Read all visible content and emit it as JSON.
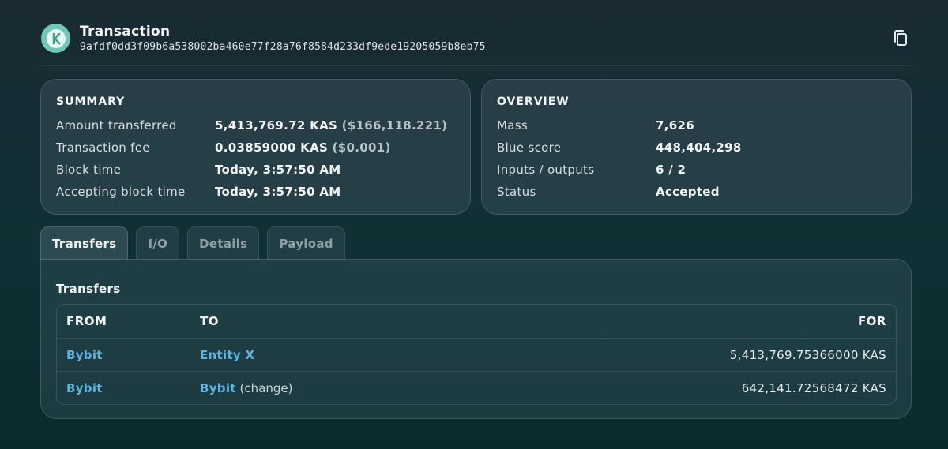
{
  "header": {
    "title": "Transaction",
    "hash": "9afdf0dd3f09b6a538002ba460e77f28a76f8584d233df9ede19205059b8eb75",
    "logo_icon": "kaspa-logo-icon",
    "copy_icon": "copy-icon"
  },
  "summary": {
    "heading": "SUMMARY",
    "rows": [
      {
        "label": "Amount transferred",
        "value": "5,413,769.72 KAS",
        "usd": "($166,118.221)"
      },
      {
        "label": "Transaction fee",
        "value": "0.03859000 KAS",
        "usd": "($0.001)"
      },
      {
        "label": "Block time",
        "value": "Today, 3:57:50 AM"
      },
      {
        "label": "Accepting block time",
        "value": "Today, 3:57:50 AM"
      }
    ]
  },
  "overview": {
    "heading": "OVERVIEW",
    "rows": [
      {
        "label": "Mass",
        "value": "7,626"
      },
      {
        "label": "Blue score",
        "value": "448,404,298"
      },
      {
        "label": "Inputs / outputs",
        "value": "6 / 2"
      },
      {
        "label": "Status",
        "value": "Accepted"
      }
    ]
  },
  "tabs": [
    {
      "label": "Transfers",
      "active": true
    },
    {
      "label": "I/O"
    },
    {
      "label": "Details"
    },
    {
      "label": "Payload"
    }
  ],
  "transfers": {
    "heading": "Transfers",
    "columns": {
      "from": "FROM",
      "to": "TO",
      "for": "FOR"
    },
    "rows": [
      {
        "from": "Bybit",
        "to": "Entity X",
        "to_note": "",
        "amount": "5,413,769.75366000 KAS"
      },
      {
        "from": "Bybit",
        "to": "Bybit",
        "to_note": "(change)",
        "amount": "642,141.72568472 KAS"
      }
    ]
  },
  "colors": {
    "accent_link": "#5fb3e0",
    "logo": "#6fc7b6"
  }
}
